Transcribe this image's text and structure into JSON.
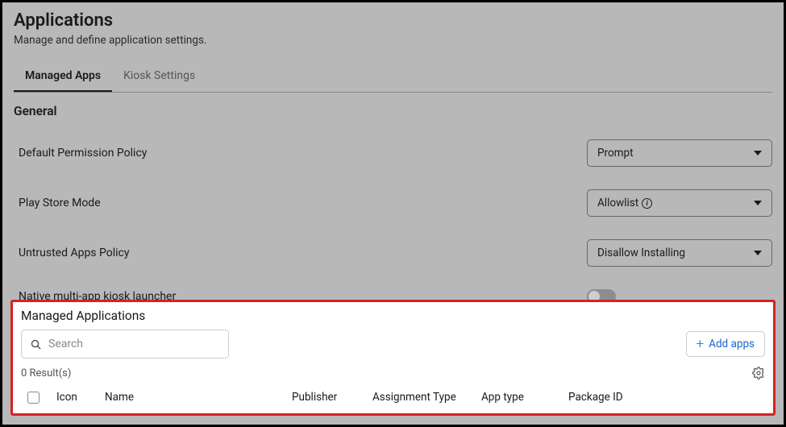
{
  "header": {
    "title": "Applications",
    "subtitle": "Manage and define application settings."
  },
  "tabs": {
    "managed": "Managed Apps",
    "kiosk": "Kiosk Settings"
  },
  "general": {
    "heading": "General",
    "permission_label": "Default Permission Policy",
    "permission_value": "Prompt",
    "playstore_label": "Play Store Mode",
    "playstore_value": "Allowlist",
    "untrusted_label": "Untrusted Apps Policy",
    "untrusted_value": "Disallow Installing",
    "kiosk_launcher_label": "Native multi-app kiosk launcher"
  },
  "managed_apps_panel": {
    "title": "Managed Applications",
    "search_placeholder": "Search",
    "add_button": "Add apps",
    "results_text": "0 Result(s)",
    "columns": {
      "icon": "Icon",
      "name": "Name",
      "publisher": "Publisher",
      "assignment": "Assignment Type",
      "apptype": "App type",
      "package": "Package ID"
    }
  }
}
